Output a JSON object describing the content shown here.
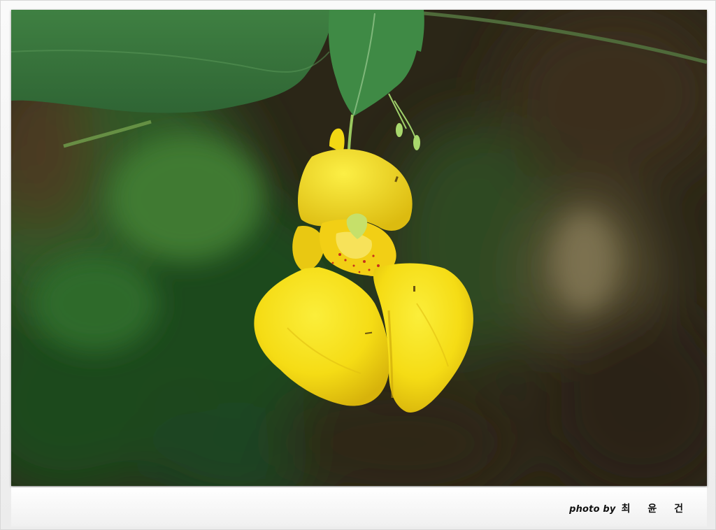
{
  "photo": {
    "subject": "yellow-jewelweed-flower",
    "colors": {
      "petal": "#f7e11a",
      "petal_shade": "#d9b50c",
      "leaf": "#3b7a3e",
      "background_dark": "#2c2617",
      "spots": "#c7311c"
    }
  },
  "credit": {
    "prefix": "photo by",
    "name": "최 윤 건"
  }
}
